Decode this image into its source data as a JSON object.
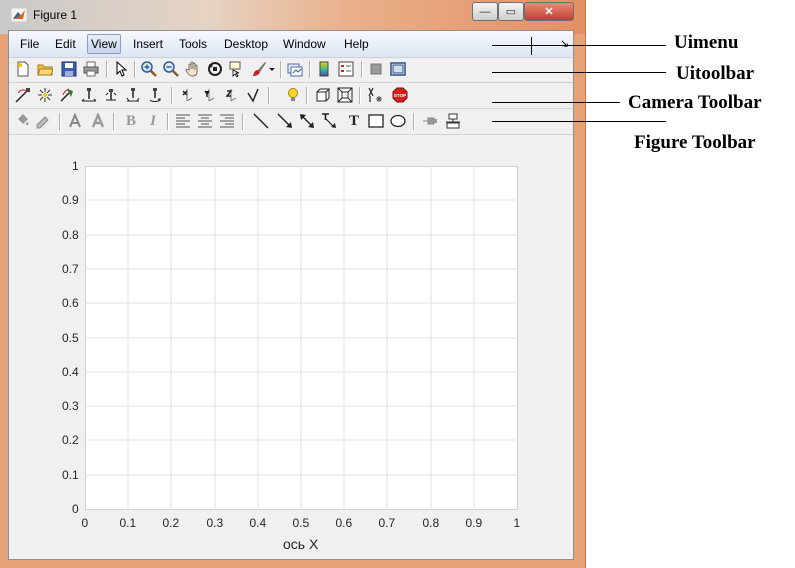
{
  "window": {
    "title": "Figure 1",
    "minimize_glyph": "—",
    "maximize_glyph": "▭",
    "close_glyph": "✕"
  },
  "menubar": {
    "items": [
      "File",
      "Edit",
      "View",
      "Insert",
      "Tools",
      "Desktop",
      "Window",
      "Help"
    ],
    "active": "View",
    "overflow_glyph": "↘"
  },
  "uitoolbar": {
    "icons": [
      "new-figure-icon",
      "open-file-icon",
      "save-icon",
      "print-icon",
      "edit-plot-icon",
      "zoom-in-icon",
      "zoom-out-icon",
      "pan-icon",
      "rotate-3d-icon",
      "data-cursor-icon",
      "brush-icon",
      "brush-dropdown-icon",
      "link-plot-icon",
      "insert-colorbar-icon",
      "insert-legend-icon",
      "hide-plot-tools-icon",
      "show-plot-tools-icon"
    ]
  },
  "camera_toolbar": {
    "icons": [
      "orbit-camera-icon",
      "orbit-light-icon",
      "pan-tilt-camera-icon",
      "move-camera-horizontally-icon",
      "move-camera-forward-icon",
      "zoom-camera-icon",
      "roll-camera-icon",
      "x-principal-axis-icon",
      "y-principal-axis-icon",
      "z-principal-axis-icon",
      "no-principal-axis-icon",
      "toggle-scene-light-icon",
      "orthographic-projection-icon",
      "perspective-projection-icon",
      "reset-camera-icon",
      "stop-camera-icon"
    ],
    "stop_text": "STOP"
  },
  "figure_toolbar": {
    "icons": [
      "face-color-icon",
      "edge-color-icon",
      "text-color-icon",
      "font-icon",
      "bold-icon",
      "italic-icon",
      "align-left-icon",
      "align-center-icon",
      "align-right-icon",
      "line-icon",
      "arrow-icon",
      "double-arrow-icon",
      "text-arrow-icon",
      "text-box-icon",
      "rectangle-icon",
      "ellipse-icon",
      "pin-icon",
      "align-distribute-icon"
    ],
    "bold_glyph": "B",
    "italic_glyph": "I",
    "text_glyph": "T"
  },
  "axes": {
    "x_ticks": [
      "0",
      "0.1",
      "0.2",
      "0.3",
      "0.4",
      "0.5",
      "0.6",
      "0.7",
      "0.8",
      "0.9",
      "1"
    ],
    "y_ticks": [
      "0",
      "0.1",
      "0.2",
      "0.3",
      "0.4",
      "0.5",
      "0.6",
      "0.7",
      "0.8",
      "0.9",
      "1"
    ],
    "xlabel": "ось X",
    "grid": true
  },
  "annotations": {
    "uimenu": "Uimenu",
    "uitoolbar": "Uitoolbar",
    "camera_toolbar": "Camera Toolbar",
    "figure_toolbar": "Figure Toolbar"
  }
}
